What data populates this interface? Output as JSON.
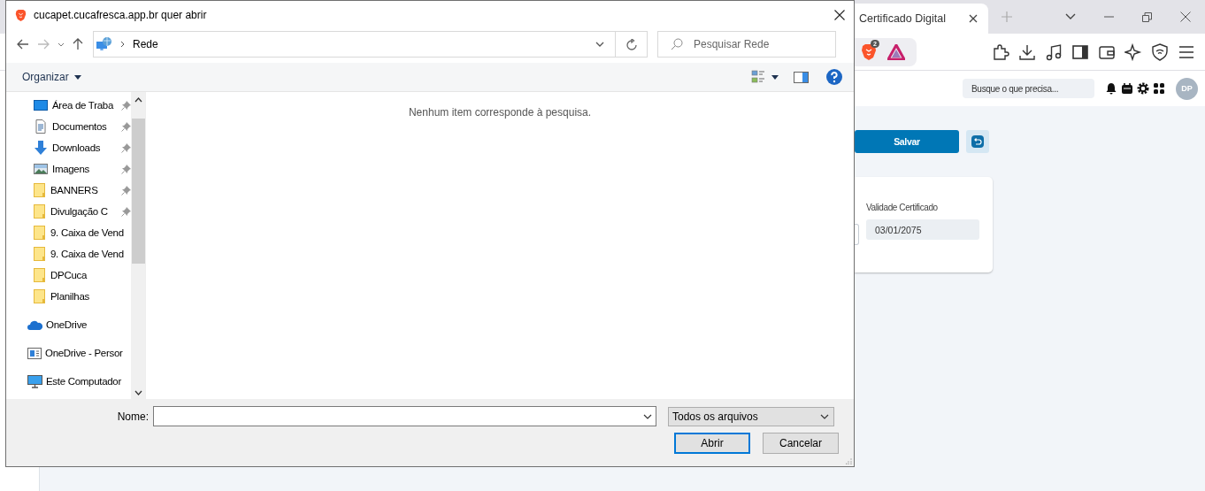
{
  "browser": {
    "tab": {
      "title": "Certificado Digital"
    },
    "shields_count": "2"
  },
  "app": {
    "search": {
      "placeholder": "Busque o que precisa..."
    },
    "avatar": "DP",
    "save_button": "Salvar",
    "certificate_field": {
      "label": "Validade Certificado",
      "value": "03/01/2075"
    }
  },
  "dialog": {
    "title": "cucapet.cucafresca.app.br quer abrir",
    "address": {
      "path": "Rede"
    },
    "search": {
      "placeholder": "Pesquisar Rede"
    },
    "organize": "Organizar",
    "nav_tree": [
      {
        "children": [
          {
            "label": "Área de Traba",
            "kind": "desktop",
            "pinned": true
          },
          {
            "label": "Documentos",
            "kind": "documents",
            "pinned": true
          },
          {
            "label": "Downloads",
            "kind": "downloads",
            "pinned": true
          },
          {
            "label": "Imagens",
            "kind": "pictures",
            "pinned": true
          },
          {
            "label": "BANNERS",
            "kind": "folder",
            "pinned": true
          },
          {
            "label": "Divulgação C",
            "kind": "folder",
            "pinned": true
          },
          {
            "label": "9. Caixa de Vend",
            "kind": "folder",
            "pinned": false
          },
          {
            "label": "9. Caixa de Vend",
            "kind": "folder",
            "pinned": false
          },
          {
            "label": "DPCuca",
            "kind": "folder",
            "pinned": false
          },
          {
            "label": "Planilhas",
            "kind": "folder",
            "pinned": false
          }
        ]
      },
      {
        "label": "OneDrive",
        "kind": "cloud",
        "pinned": false
      },
      {
        "label": "OneDrive - Persor",
        "kind": "onedrive-business",
        "pinned": false
      },
      {
        "label": "Este Computador",
        "kind": "computer",
        "pinned": false
      }
    ],
    "empty_message": "Nenhum item corresponde à pesquisa.",
    "filename": {
      "label": "Nome:"
    },
    "filetype": "Todos os arquivos",
    "buttons": [
      {
        "label": "Abrir",
        "default": true
      },
      {
        "label": "Cancelar",
        "default": false
      }
    ]
  }
}
